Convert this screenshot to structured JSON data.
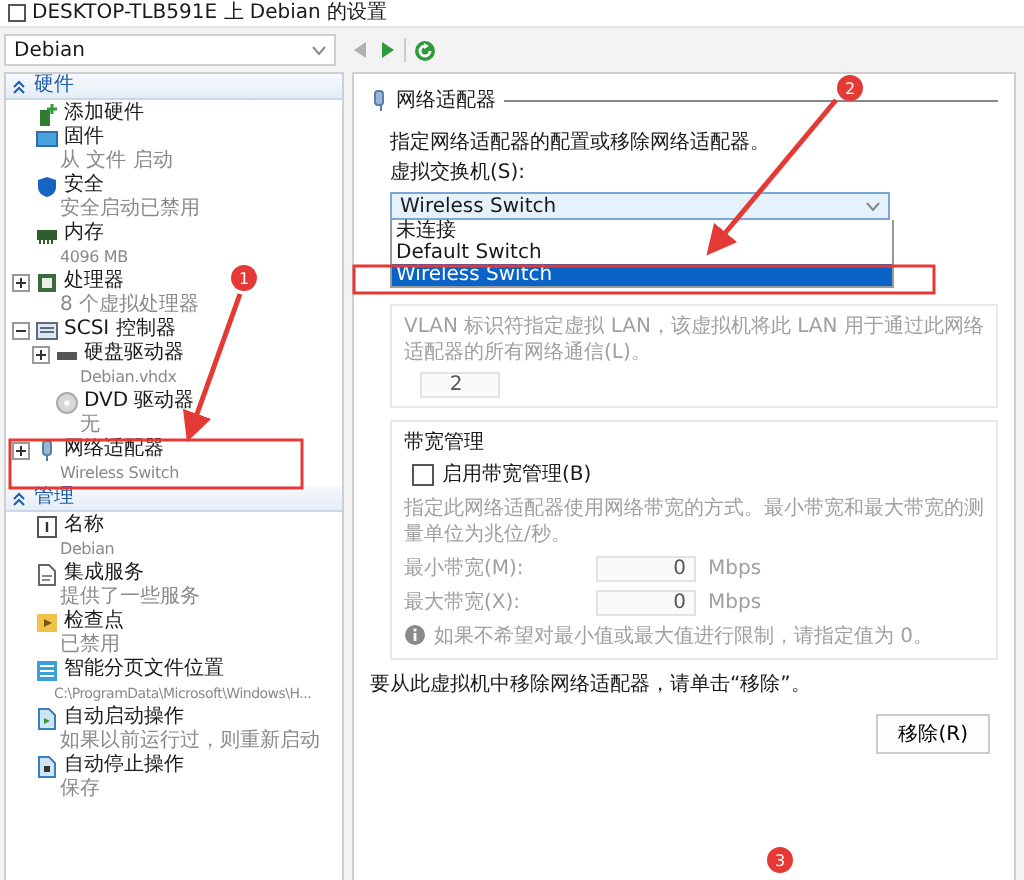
{
  "window": {
    "title": "DESKTOP-TLB591E 上 Debian 的设置"
  },
  "vm_selector": {
    "value": "Debian"
  },
  "toolbar": [
    {
      "kind": "back",
      "disabled": true
    },
    {
      "kind": "forward",
      "disabled": false
    },
    {
      "kind": "refresh",
      "disabled": false
    }
  ],
  "sidebar": {
    "sections": [
      {
        "title": "硬件",
        "expanded": true,
        "items": [
          {
            "kind": "add-hardware",
            "label": "添加硬件"
          },
          {
            "kind": "firmware",
            "label": "固件",
            "detail": "从 文件 启动"
          },
          {
            "kind": "security",
            "label": "安全",
            "detail": "安全启动已禁用"
          },
          {
            "kind": "memory",
            "label": "内存",
            "detail": "4096 MB"
          },
          {
            "kind": "processor",
            "label": "处理器",
            "detail": "8 个虚拟处理器",
            "expanded": false
          },
          {
            "kind": "scsi",
            "label": "SCSI 控制器",
            "expanded": true,
            "children": [
              {
                "kind": "disk",
                "label": "硬盘驱动器",
                "detail": "Debian.vhdx",
                "expanded": false
              },
              {
                "kind": "dvd",
                "label": "DVD 驱动器",
                "detail": "无"
              }
            ]
          },
          {
            "kind": "network",
            "label": "网络适配器",
            "detail": "Wireless Switch",
            "expanded": false
          }
        ]
      },
      {
        "title": "管理",
        "expanded": true,
        "items": [
          {
            "kind": "name",
            "label": "名称",
            "detail": "Debian"
          },
          {
            "kind": "integration",
            "label": "集成服务",
            "detail": "提供了一些服务"
          },
          {
            "kind": "checkpoint",
            "label": "检查点",
            "detail": "已禁用"
          },
          {
            "kind": "paging",
            "label": "智能分页文件位置",
            "detail": "C:\\ProgramData\\Microsoft\\Windows\\H..."
          },
          {
            "kind": "autostart",
            "label": "自动启动操作",
            "detail": "如果以前运行过，则重新启动"
          },
          {
            "kind": "autostop",
            "label": "自动停止操作",
            "detail": "保存"
          }
        ]
      }
    ]
  },
  "settings": {
    "title": "网络适配器",
    "description": "指定网络适配器的配置或移除网络适配器。",
    "switch_label": "虚拟交换机(S):",
    "switch_value": "Wireless Switch",
    "switch_options": [
      {
        "label": "未连接",
        "selected": false
      },
      {
        "label": "Default Switch",
        "selected": false
      },
      {
        "label": "Wireless Switch",
        "selected": true
      }
    ],
    "vlan": {
      "text": "VLAN 标识符指定虚拟 LAN，该虚拟机将此 LAN 用于通过此网络适配器的所有网络通信(L)。",
      "value": "2",
      "disabled": true
    },
    "bandwidth": {
      "title": "带宽管理",
      "checkbox": {
        "label": "启用带宽管理(B)",
        "checked": false
      },
      "text": "指定此网络适配器使用网络带宽的方式。最小带宽和最大带宽的测量单位为兆位/秒。",
      "disabled": true,
      "fields": [
        {
          "label": "最小带宽(M):",
          "value": "0",
          "unit": "Mbps"
        },
        {
          "label": "最大带宽(X):",
          "value": "0",
          "unit": "Mbps"
        }
      ],
      "note": "如果不希望对最小值或最大值进行限制，请指定值为 0。"
    },
    "remove_text": "要从此虚拟机中移除网络适配器，请单击“移除”。",
    "remove_button": "移除(R)"
  },
  "annotations": [
    {
      "label": "1"
    },
    {
      "label": "2"
    },
    {
      "label": "3"
    }
  ]
}
